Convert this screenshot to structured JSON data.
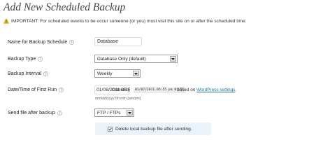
{
  "header": {
    "title": "Add New Scheduled Backup"
  },
  "notice": {
    "icon": "warning-icon",
    "text": "IMPORTANT: For scheduled events to be occur someone (or you) must visit this site on or after the scheduled time."
  },
  "form": {
    "name": {
      "label": "Name for Backup Schedule",
      "value": "Database"
    },
    "backup_type": {
      "label": "Backup Type",
      "selected": "Database Only (default)"
    },
    "backup_interval": {
      "label": "Backup Interval",
      "selected": "Weekly"
    },
    "first_run": {
      "label": "Date/Time of First Run",
      "value": "01/08/2011 05:55",
      "currently_label": "Currently",
      "current_time": "01/07/2011 05:55 pm 0 UTC",
      "based_on_text": "based on",
      "settings_link": "WordPress settings",
      "period": ".",
      "format_hint": "mm/dd/yyyy hh:mm [am/pm]"
    },
    "send_file": {
      "label": "Send file after backup",
      "selected": "FTP / FTPs"
    },
    "delete_local": {
      "checked": true,
      "label": "Delete local backup file after sending."
    }
  },
  "icons": {
    "help": "help-icon",
    "dropdown": "chevron-down-icon",
    "checkbox": "checkmark-icon"
  },
  "colors": {
    "title": "#464646",
    "link": "#21759b",
    "panel": "#eaf2fa",
    "warning": "#f0c000"
  }
}
